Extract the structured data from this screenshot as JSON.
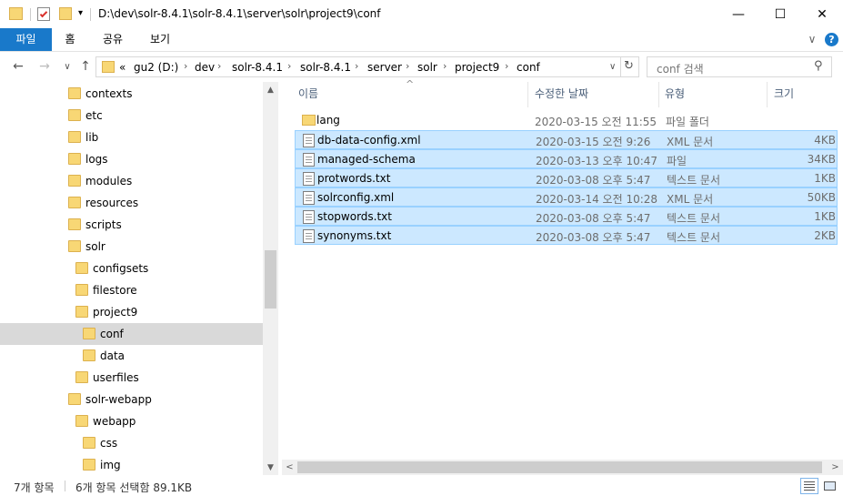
{
  "window": {
    "title": "D:\\dev\\solr-8.4.1\\solr-8.4.1\\server\\solr\\project9\\conf",
    "minimize": "—",
    "maximize": "☐",
    "close": "✕"
  },
  "ribbon": {
    "tabs": [
      "파일",
      "홈",
      "공유",
      "보기"
    ],
    "collapse": "∨",
    "help": "?"
  },
  "address": {
    "back": "←",
    "forward": "→",
    "recent": "∨",
    "up": "↑",
    "overflow": "«",
    "crumbs": [
      "gu2 (D:)",
      "dev",
      "solr-8.4.1",
      "solr-8.4.1",
      "server",
      "solr",
      "project9",
      "conf"
    ],
    "separator": "›",
    "dropdown": "∨",
    "refresh": "↻",
    "search_placeholder": "conf 검색",
    "search_icon": "⚲"
  },
  "tree": {
    "items": [
      {
        "label": "contexts",
        "level": 0
      },
      {
        "label": "etc",
        "level": 0
      },
      {
        "label": "lib",
        "level": 0
      },
      {
        "label": "logs",
        "level": 0
      },
      {
        "label": "modules",
        "level": 0
      },
      {
        "label": "resources",
        "level": 0
      },
      {
        "label": "scripts",
        "level": 0
      },
      {
        "label": "solr",
        "level": 0
      },
      {
        "label": "configsets",
        "level": 1
      },
      {
        "label": "filestore",
        "level": 1
      },
      {
        "label": "project9",
        "level": 1
      },
      {
        "label": "conf",
        "level": 2,
        "selected": true
      },
      {
        "label": "data",
        "level": 2
      },
      {
        "label": "userfiles",
        "level": 1
      },
      {
        "label": "solr-webapp",
        "level": 0
      },
      {
        "label": "webapp",
        "level": 1
      },
      {
        "label": "css",
        "level": 2
      },
      {
        "label": "img",
        "level": 2
      }
    ],
    "scroll_up": "▲",
    "scroll_down": "▼"
  },
  "list": {
    "sort_indicator": "^",
    "columns": [
      "이름",
      "수정한 날짜",
      "유형",
      "크기"
    ],
    "rows": [
      {
        "name": "lang",
        "date": "2020-03-15 오전 11:55",
        "type": "파일 폴더",
        "size": "",
        "icon": "folder-icon",
        "selected": false
      },
      {
        "name": "db-data-config.xml",
        "date": "2020-03-15 오전 9:26",
        "type": "XML 문서",
        "size": "4KB",
        "icon": "document-icon",
        "selected": true
      },
      {
        "name": "managed-schema",
        "date": "2020-03-13 오후 10:47",
        "type": "파일",
        "size": "34KB",
        "icon": "document-icon",
        "selected": true
      },
      {
        "name": "protwords.txt",
        "date": "2020-03-08 오후 5:47",
        "type": "텍스트 문서",
        "size": "1KB",
        "icon": "document-icon",
        "selected": true
      },
      {
        "name": "solrconfig.xml",
        "date": "2020-03-14 오전 10:28",
        "type": "XML 문서",
        "size": "50KB",
        "icon": "document-icon",
        "selected": true
      },
      {
        "name": "stopwords.txt",
        "date": "2020-03-08 오후 5:47",
        "type": "텍스트 문서",
        "size": "1KB",
        "icon": "document-icon",
        "selected": true
      },
      {
        "name": "synonyms.txt",
        "date": "2020-03-08 오후 5:47",
        "type": "텍스트 문서",
        "size": "2KB",
        "icon": "document-icon",
        "selected": true
      }
    ],
    "scroll_left": "<",
    "scroll_right": ">"
  },
  "status": {
    "item_count": "7개 항목",
    "selection": "6개 항목 선택함 89.1KB"
  },
  "colors": {
    "accent": "#1979ca",
    "selection_bg": "#cce8ff",
    "selection_border": "#99d1ff",
    "folder": "#f8d775"
  }
}
